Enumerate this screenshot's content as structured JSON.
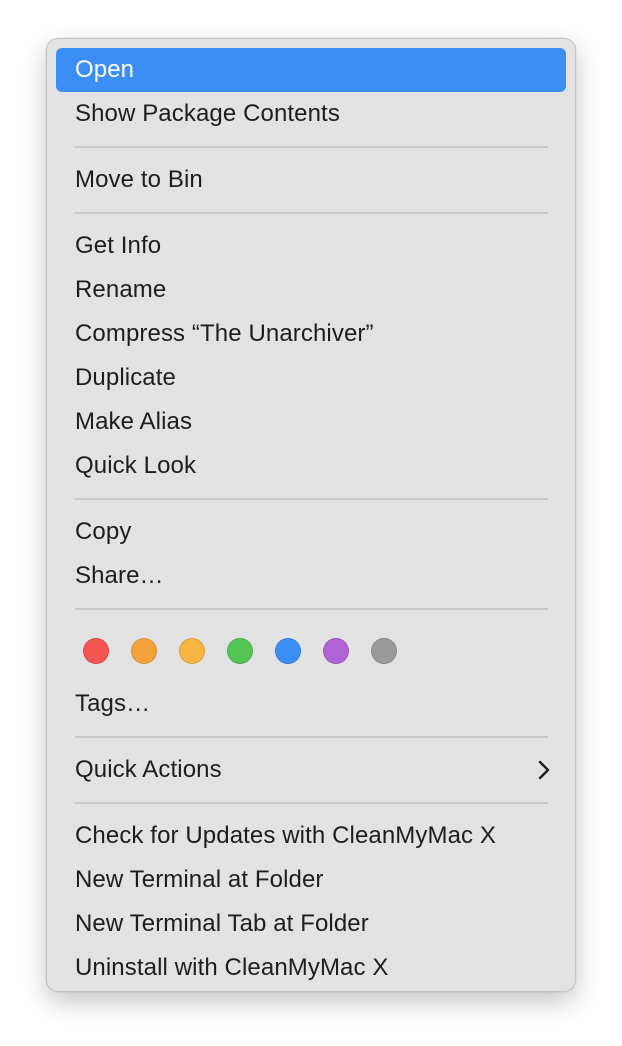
{
  "menu": {
    "groups": [
      {
        "items": [
          {
            "label": "Open",
            "highlighted": true
          },
          {
            "label": "Show Package Contents"
          }
        ]
      },
      {
        "items": [
          {
            "label": "Move to Bin"
          }
        ]
      },
      {
        "items": [
          {
            "label": "Get Info"
          },
          {
            "label": "Rename"
          },
          {
            "label": "Compress “The Unarchiver”"
          },
          {
            "label": "Duplicate"
          },
          {
            "label": "Make Alias"
          },
          {
            "label": "Quick Look"
          }
        ]
      },
      {
        "items": [
          {
            "label": "Copy"
          },
          {
            "label": "Share…"
          }
        ]
      },
      {
        "items": [
          {
            "label": "Tags…"
          }
        ]
      },
      {
        "items": [
          {
            "label": "Quick Actions",
            "submenu": true
          }
        ]
      },
      {
        "items": [
          {
            "label": "Check for Updates with CleanMyMac X"
          },
          {
            "label": "New Terminal at Folder"
          },
          {
            "label": "New Terminal Tab at Folder"
          },
          {
            "label": "Uninstall with CleanMyMac X"
          }
        ]
      }
    ],
    "tag_colors": [
      {
        "name": "red",
        "color": "#f5554f"
      },
      {
        "name": "orange",
        "color": "#f4a23a"
      },
      {
        "name": "yellow",
        "color": "#f7b541"
      },
      {
        "name": "green",
        "color": "#54c454"
      },
      {
        "name": "blue",
        "color": "#3b8ef5"
      },
      {
        "name": "purple",
        "color": "#b064d6"
      },
      {
        "name": "gray",
        "color": "#9a9a9a"
      }
    ],
    "highlight_color": "#3b8ef5",
    "submenu_icon": "chevron-right-icon"
  }
}
